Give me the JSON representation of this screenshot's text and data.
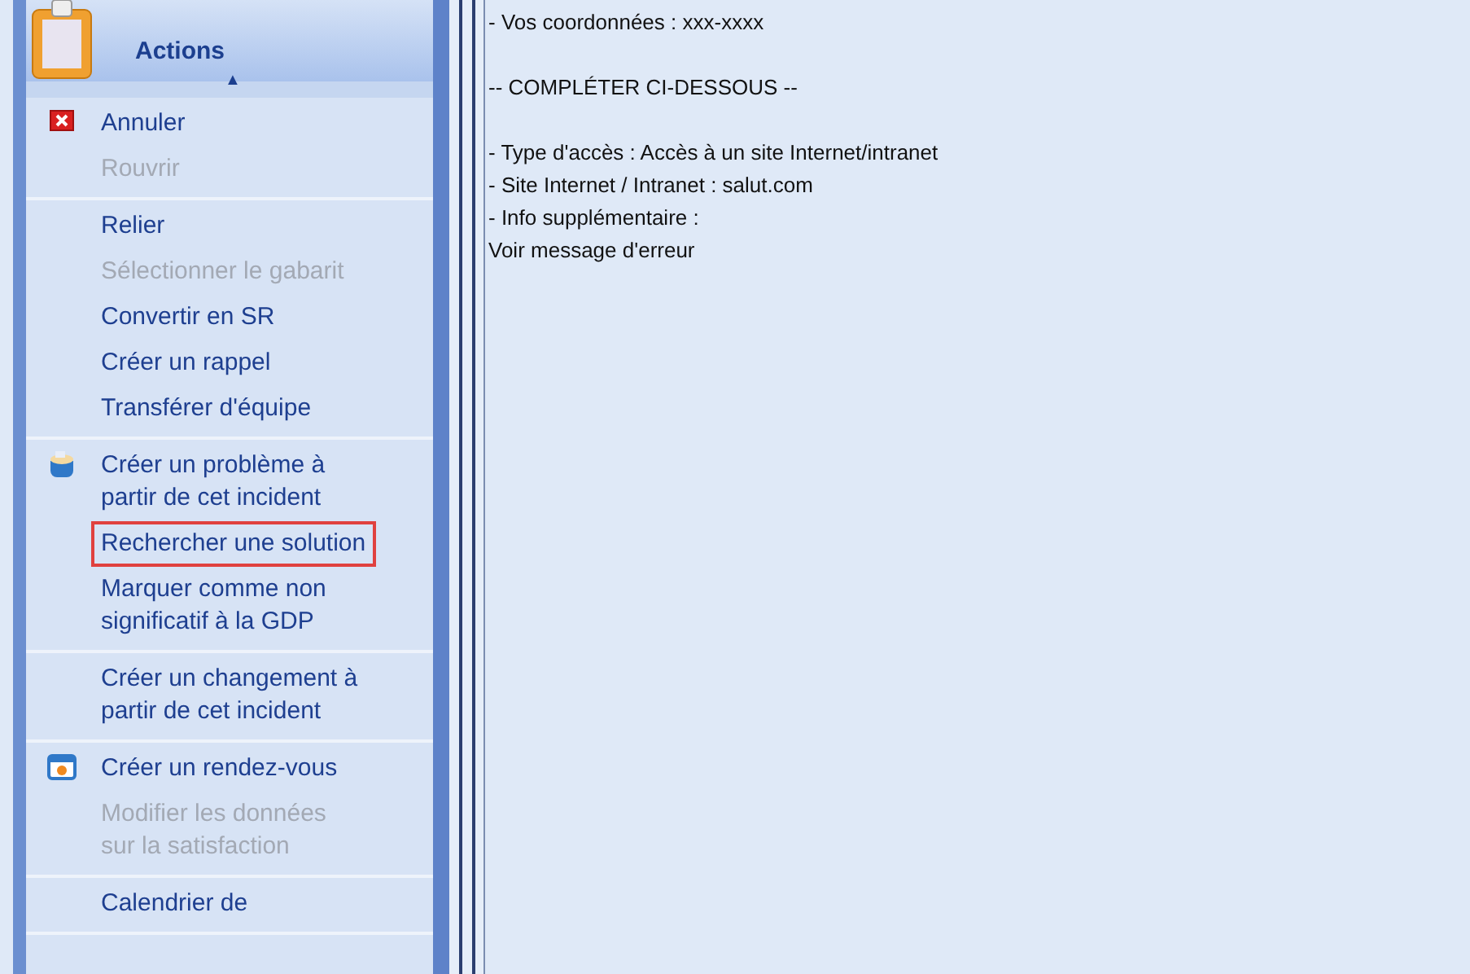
{
  "actions_panel": {
    "title": "Actions",
    "collapse": "▲",
    "groups": [
      {
        "items": [
          {
            "label": "Annuler",
            "kind": "cancel",
            "disabled": false,
            "highlighted": false
          },
          {
            "label": "Rouvrir",
            "kind": "plain",
            "disabled": true,
            "highlighted": false
          }
        ]
      },
      {
        "items": [
          {
            "label": "Relier",
            "kind": "plain",
            "disabled": false,
            "highlighted": false
          },
          {
            "label": "Sélectionner le gabarit",
            "kind": "plain",
            "disabled": true,
            "highlighted": false
          },
          {
            "label": "Convertir en SR",
            "kind": "plain",
            "disabled": false,
            "highlighted": false
          },
          {
            "label": "Créer un rappel",
            "kind": "plain",
            "disabled": false,
            "highlighted": false
          },
          {
            "label": "Transférer d'équipe",
            "kind": "plain",
            "disabled": false,
            "highlighted": false
          }
        ]
      },
      {
        "items": [
          {
            "label": "Créer un problème à\npartir de cet incident",
            "kind": "problem",
            "disabled": false,
            "highlighted": false
          },
          {
            "label": "Rechercher une solution",
            "kind": "plain",
            "disabled": false,
            "highlighted": true
          },
          {
            "label": "Marquer comme non\nsignificatif à la GDP",
            "kind": "plain",
            "disabled": false,
            "highlighted": false
          }
        ]
      },
      {
        "items": [
          {
            "label": "Créer un changement à\npartir de cet incident",
            "kind": "plain",
            "disabled": false,
            "highlighted": false
          }
        ]
      },
      {
        "items": [
          {
            "label": "Créer un rendez-vous",
            "kind": "calendar",
            "disabled": false,
            "highlighted": false
          },
          {
            "label": "Modifier les données\nsur la satisfaction",
            "kind": "plain",
            "disabled": true,
            "highlighted": false
          }
        ]
      },
      {
        "items": [
          {
            "label": "Calendrier de",
            "kind": "plain",
            "disabled": false,
            "highlighted": false
          }
        ]
      }
    ]
  },
  "description": {
    "paragraphs": [
      [
        "- Vos coordonnées : xxx-xxxx"
      ],
      [
        "-- COMPLÉTER CI-DESSOUS --"
      ],
      [
        "- Type d'accès : Accès à un site Internet/intranet",
        "- Site Internet / Intranet : salut.com",
        "- Info supplémentaire :",
        "Voir message d'erreur"
      ]
    ]
  }
}
